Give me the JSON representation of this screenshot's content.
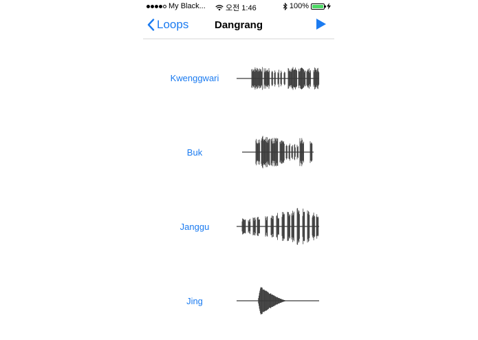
{
  "status_bar": {
    "signal_dots": 4,
    "signal_total": 5,
    "carrier": "My Black...",
    "time": "오전 1:46",
    "battery_percent_label": "100%",
    "battery_level": 1.0,
    "icons": [
      "wifi-icon",
      "bluetooth-icon",
      "battery-icon",
      "charging-icon"
    ]
  },
  "nav": {
    "back_label": "Loops",
    "title": "Dangrang",
    "play_icon": "play-icon",
    "accent_color": "#1b7bf0"
  },
  "tracks": [
    {
      "label": "Kwenggwari"
    },
    {
      "label": "Buk"
    },
    {
      "label": "Janggu"
    },
    {
      "label": "Jing"
    }
  ],
  "waveform_color": "#3a3a3a"
}
